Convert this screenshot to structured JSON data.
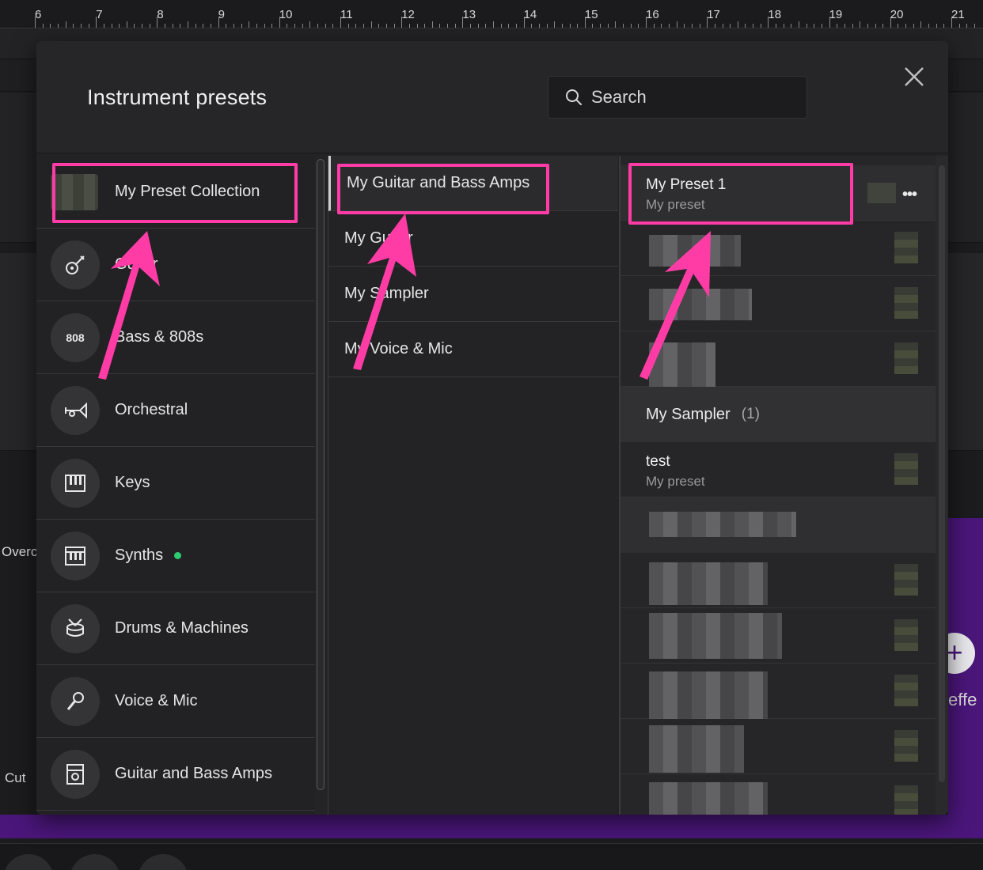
{
  "ruler": {
    "numbers": [
      "6",
      "7",
      "8",
      "9",
      "10",
      "11",
      "12",
      "13",
      "14",
      "15",
      "16",
      "17",
      "18",
      "19",
      "20",
      "21"
    ]
  },
  "background": {
    "left_label_1": "Overc",
    "left_label_2": "Cut",
    "right_label": "effe",
    "plus_symbol": "+"
  },
  "modal": {
    "title": "Instrument presets",
    "search_placeholder": "Search",
    "close_symbol": "×"
  },
  "categories": [
    {
      "label": "My Preset Collection",
      "icon": "collection-thumbnail"
    },
    {
      "label": "Guitar",
      "icon": "guitar-icon"
    },
    {
      "label": "Bass & 808s",
      "icon": "808-icon",
      "icon_text": "808"
    },
    {
      "label": "Orchestral",
      "icon": "trumpet-icon"
    },
    {
      "label": "Keys",
      "icon": "piano-icon"
    },
    {
      "label": "Synths",
      "icon": "synth-icon",
      "has_dot": true
    },
    {
      "label": "Drums & Machines",
      "icon": "drum-icon"
    },
    {
      "label": "Voice & Mic",
      "icon": "mic-icon"
    },
    {
      "label": "Guitar and Bass Amps",
      "icon": "amp-icon"
    }
  ],
  "subcategories": [
    {
      "label": "My Guitar and Bass Amps",
      "active": true
    },
    {
      "label": "My Guitar"
    },
    {
      "label": "My Sampler"
    },
    {
      "label": "My Voice & Mic"
    }
  ],
  "presets": {
    "first": {
      "name": "My Preset 1",
      "sub": "My preset",
      "more": "•••"
    },
    "group": {
      "name": "My Sampler",
      "count": "(1)"
    },
    "test": {
      "name": "test",
      "sub": "My preset"
    }
  },
  "colors": {
    "highlight": "#ff3ca6",
    "accent_purple": "#4a167a",
    "dot_green": "#2ecc71"
  }
}
